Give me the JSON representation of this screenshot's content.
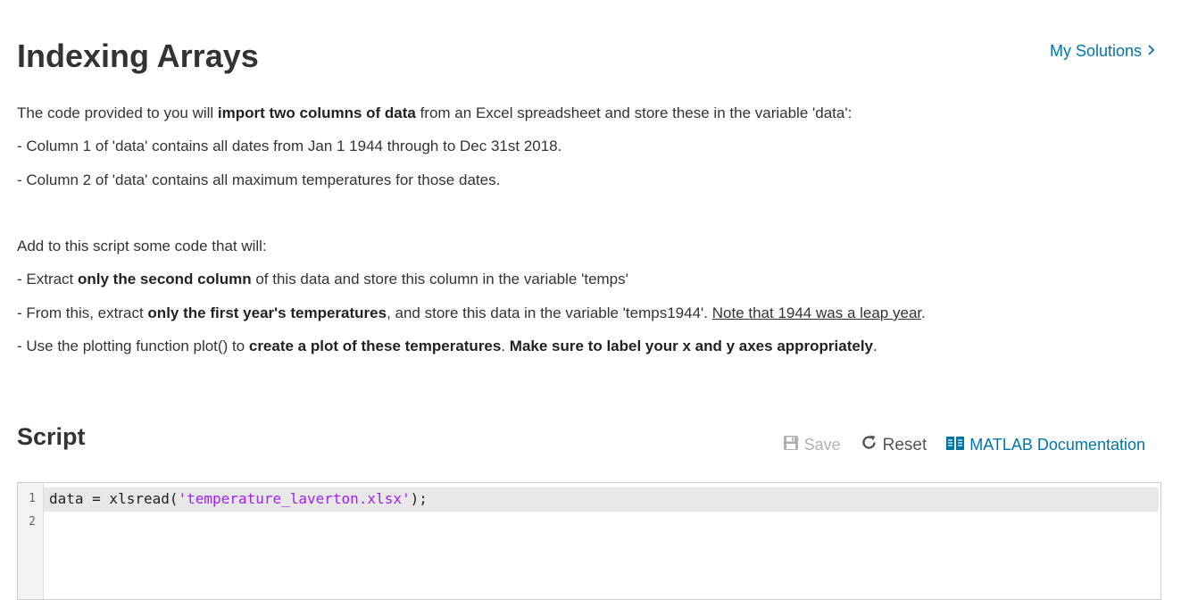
{
  "header": {
    "title": "Indexing Arrays",
    "my_solutions_label": "My Solutions"
  },
  "description": {
    "p1_a": "The code provided to you will ",
    "p1_b": "import two columns of data",
    "p1_c": " from an Excel spreadsheet and store these in the variable 'data':",
    "p2": "- Column 1 of 'data' contains all dates from Jan 1 1944 through to Dec 31st 2018.",
    "p3": "- Column 2 of 'data' contains all maximum temperatures for those dates.",
    "p4": "Add to this script some code that will:",
    "p5_a": "- Extract ",
    "p5_b": "only the second column",
    "p5_c": " of this data and store this column in the variable 'temps'",
    "p6_a": "- From this, extract ",
    "p6_b": "only the first year's temperatures",
    "p6_c": ", and store this data in the variable 'temps1944'. ",
    "p6_d": "Note that 1944 was a leap year",
    "p6_e": ".",
    "p7_a": "- Use the plotting function plot() to ",
    "p7_b": "create a plot of these temperatures",
    "p7_c": ". ",
    "p7_d": "Make sure to label your x and y axes appropriately",
    "p7_e": "."
  },
  "script": {
    "title": "Script",
    "toolbar": {
      "save_label": "Save",
      "reset_label": "Reset",
      "docs_label": "MATLAB Documentation"
    },
    "lines": [
      {
        "num": "1",
        "pre": "data = xlsread(",
        "str": "'temperature_laverton.xlsx'",
        "post": ");"
      },
      {
        "num": "2",
        "pre": "",
        "str": "",
        "post": ""
      }
    ]
  },
  "colors": {
    "link": "#0076a8",
    "string_literal": "#a020f0",
    "active_line_bg": "#e8e8e8",
    "disabled": "#b0b0b0"
  },
  "icons": {
    "my_solutions": "chevron-right-icon",
    "save": "floppy-disk-icon",
    "reset": "refresh-icon",
    "docs": "book-icon"
  }
}
